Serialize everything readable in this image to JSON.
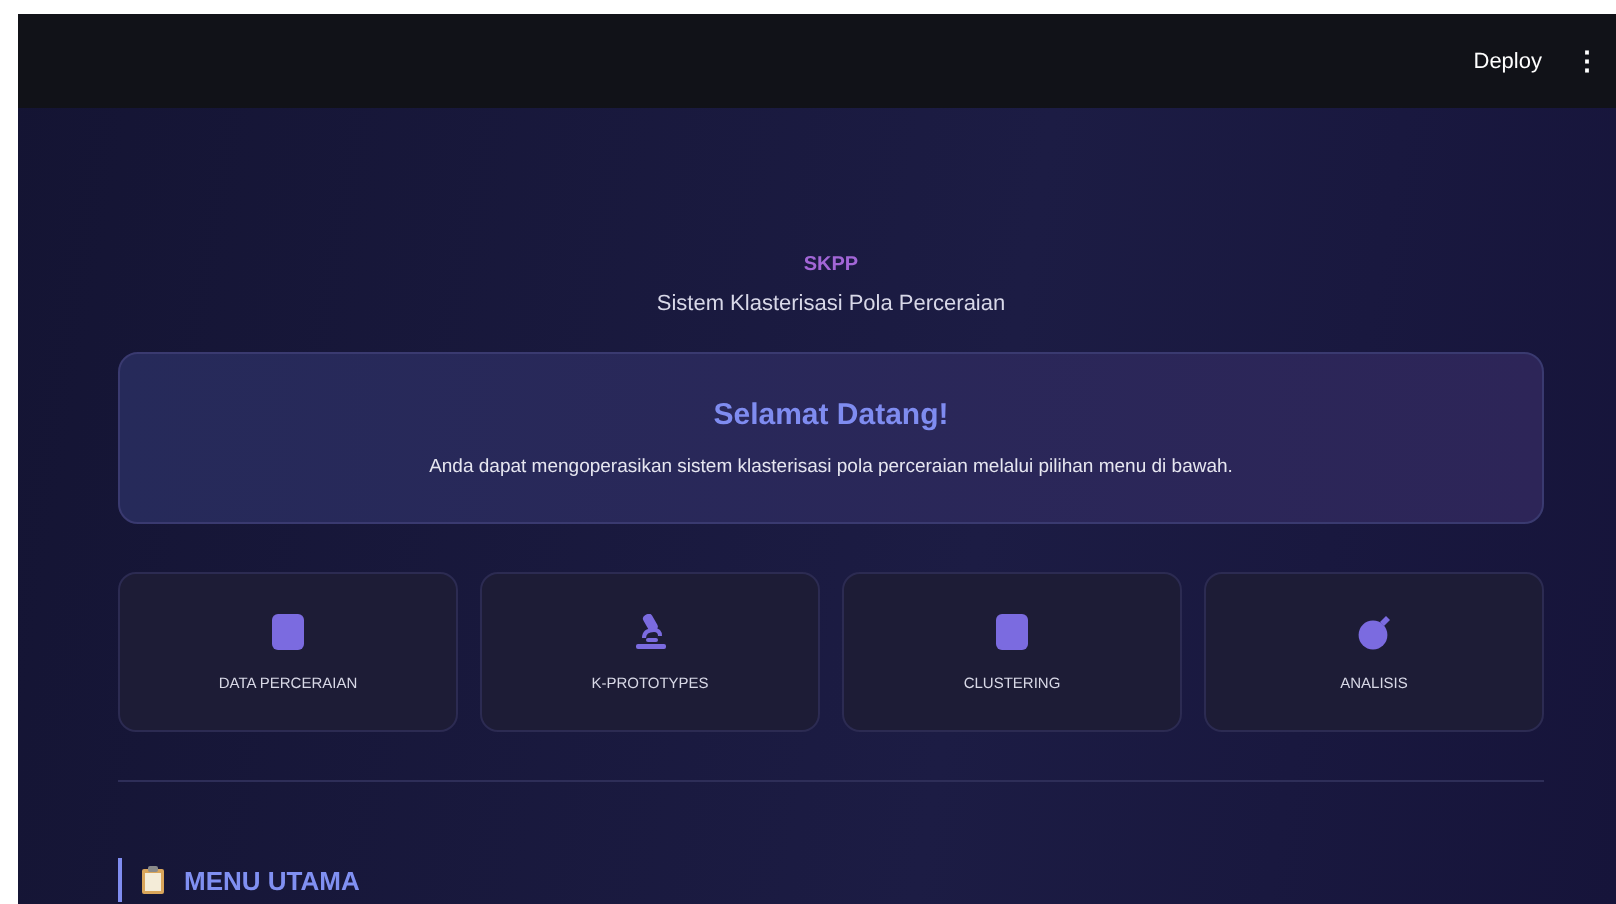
{
  "header": {
    "deploy": "Deploy",
    "menu": "⋮"
  },
  "brand": {
    "title": "SKPP",
    "subtitle": "Sistem Klasterisasi Pola Perceraian"
  },
  "banner": {
    "title": "Selamat Datang!",
    "text": "Anda dapat mengoperasikan sistem klasterisasi pola perceraian melalui pilihan menu di bawah."
  },
  "cards": [
    {
      "kind": "square",
      "label": "DATA PERCERAIAN"
    },
    {
      "kind": "microscope",
      "label": "K-PROTOTYPES"
    },
    {
      "kind": "square",
      "label": "CLUSTERING"
    },
    {
      "kind": "bomb",
      "label": "ANALISIS"
    }
  ],
  "section": {
    "title": "MENU UTAMA"
  }
}
